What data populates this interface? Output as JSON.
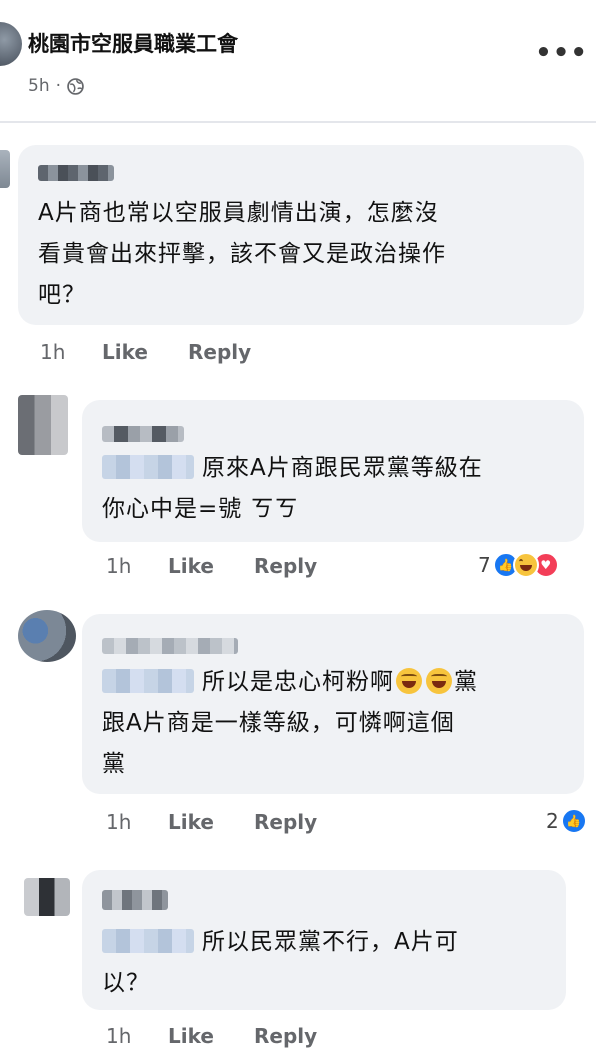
{
  "post": {
    "page_name": "桃園市空服員職業工會",
    "time": "5h",
    "separator": "·"
  },
  "comments": [
    {
      "text_lines": [
        "A片商也常以空服員劇情出演，怎麼沒",
        "看貴會出來抨擊，該不會又是政治操作",
        "吧？"
      ],
      "time": "1h",
      "like": "Like",
      "reply": "Reply"
    },
    {
      "text_lines": [
        "原來A片商跟民眾黨等級在",
        "你心中是=號 ㄎㄎ"
      ],
      "time": "1h",
      "like": "Like",
      "reply": "Reply",
      "reaction_count": "7"
    },
    {
      "text_lines": [
        "所以是忠心柯粉啊",
        "黨",
        "跟A片商是一樣等級，可憐啊這個",
        "黨"
      ],
      "time": "1h",
      "like": "Like",
      "reply": "Reply",
      "reaction_count": "2"
    },
    {
      "text_lines": [
        "所以民眾黨不行，A片可",
        "以？"
      ],
      "time": "1h",
      "like": "Like",
      "reply": "Reply"
    }
  ],
  "icons": {
    "more": "more-options-icon",
    "globe": "globe-icon",
    "reactions": [
      "like-reaction-icon",
      "haha-reaction-icon",
      "love-reaction-icon"
    ]
  },
  "colors": {
    "bubble": "#f0f2f5",
    "like_blue": "#1877f2",
    "meta_gray": "#65676b"
  }
}
